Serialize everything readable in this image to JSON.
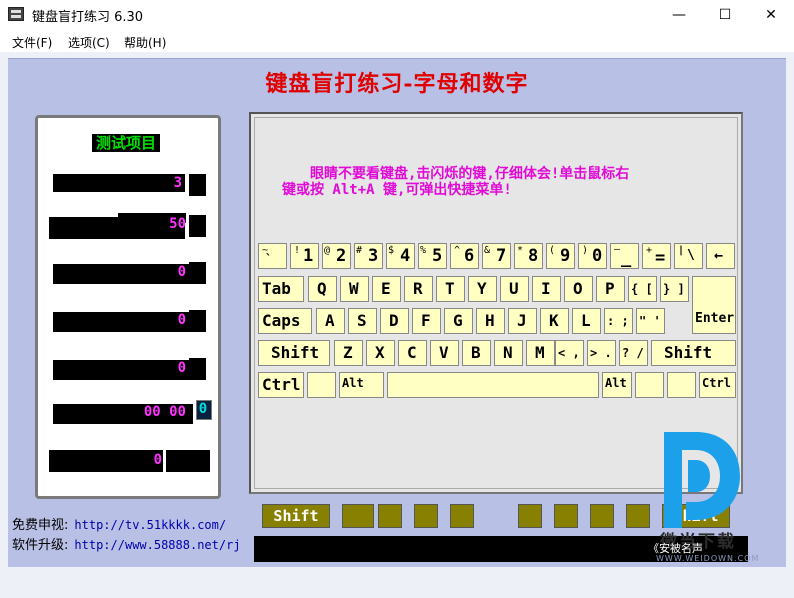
{
  "window": {
    "title": "键盘盲打练习 6.30",
    "minimize": "—",
    "maximize": "☐",
    "close": "✕"
  },
  "menu": [
    "文件(F)",
    "选项(C)",
    "帮助(H)"
  ],
  "main_title": "键盘盲打练习-字母和数字",
  "stats": {
    "title": "测试项目",
    "values": [
      "3",
      "50",
      "0",
      "0",
      "0",
      "00  00",
      "0"
    ],
    "side_value": "0"
  },
  "instruction": {
    "line1": "眼睛不要看键盘,击闪烁的键,仔细体会!单击鼠标右",
    "line2": "键或按 Alt+A 键,可弹出快捷菜单!"
  },
  "keyboard": {
    "row1": [
      {
        "top": "~",
        "bottom": "`"
      },
      {
        "top": "!",
        "bottom": "1"
      },
      {
        "top": "@",
        "bottom": "2"
      },
      {
        "top": "#",
        "bottom": "3"
      },
      {
        "top": "$",
        "bottom": "4"
      },
      {
        "top": "%",
        "bottom": "5"
      },
      {
        "top": "^",
        "bottom": "6"
      },
      {
        "top": "&",
        "bottom": "7"
      },
      {
        "top": "*",
        "bottom": "8"
      },
      {
        "top": "(",
        "bottom": "9"
      },
      {
        "top": ")",
        "bottom": "0"
      },
      {
        "top": "—",
        "bottom": "_"
      },
      {
        "top": "+",
        "bottom": "="
      },
      {
        "top": "|",
        "bottom": "\\"
      },
      {
        "top": "←",
        "bottom": ""
      }
    ],
    "row2": [
      "Tab",
      "Q",
      "W",
      "E",
      "R",
      "T",
      "Y",
      "U",
      "I",
      "O",
      "P",
      "{ [",
      "} ]",
      "Enter"
    ],
    "row3": [
      "Caps",
      "A",
      "S",
      "D",
      "F",
      "G",
      "H",
      "J",
      "K",
      "L",
      ": ;",
      "\" '"
    ],
    "row4": [
      "Shift",
      "Z",
      "X",
      "C",
      "V",
      "B",
      "N",
      "M",
      "< ,",
      "> .",
      "? /",
      "Shift"
    ],
    "row5": [
      "Ctrl",
      "",
      "Alt",
      "",
      "Alt",
      "",
      "",
      "Ctrl"
    ]
  },
  "bottom": {
    "shift_left": "Shift",
    "shift_right": "Shift"
  },
  "links": {
    "tv_label": "免费申视:",
    "tv_url": "http://tv.51kkkk.com/",
    "upgrade_label": "软件升级:",
    "upgrade_url": "http://www.58888.net/rj"
  },
  "watermark": {
    "text": "微当下载",
    "url": "WWW.WEIDOWN.COM",
    "status": "《安被名声"
  },
  "colors": {
    "title_red": "#e00000",
    "instruction_magenta": "#e00cd6",
    "key_fill": "#ffffc4",
    "olive": "#888000",
    "panel_blue": "#b9c0e6",
    "stat_green": "#00e000"
  }
}
